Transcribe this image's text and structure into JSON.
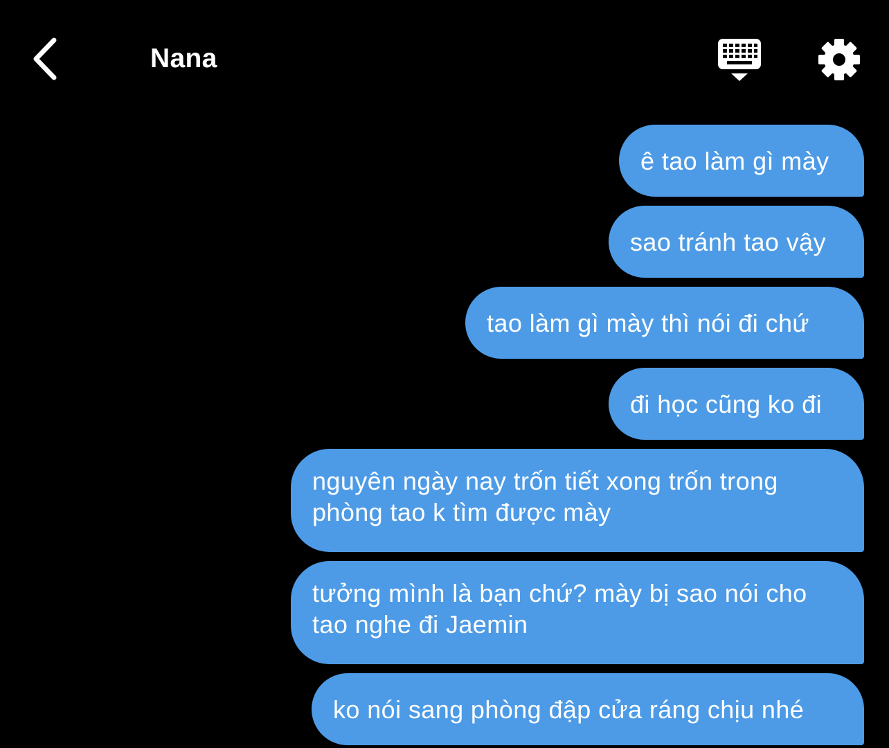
{
  "header": {
    "contact_name": "Nana",
    "back_icon": "chevron-left-icon",
    "keyboard_icon": "keyboard-dismiss-icon",
    "settings_icon": "gear-icon"
  },
  "colors": {
    "background": "#000000",
    "bubble": "#4d9be6",
    "text": "#ffffff"
  },
  "messages": [
    {
      "text": "ê tao làm gì mày"
    },
    {
      "text": "sao tránh tao vậy"
    },
    {
      "text": "tao làm gì mày thì nói đi chứ"
    },
    {
      "text": "đi học cũng ko đi"
    },
    {
      "text": "nguyên ngày nay trốn tiết xong trốn trong phòng tao k tìm được mày"
    },
    {
      "text": "tưởng mình là bạn chứ? mày bị sao nói cho tao nghe đi Jaemin"
    },
    {
      "text": "ko nói sang phòng đập cửa ráng chịu nhé"
    }
  ]
}
